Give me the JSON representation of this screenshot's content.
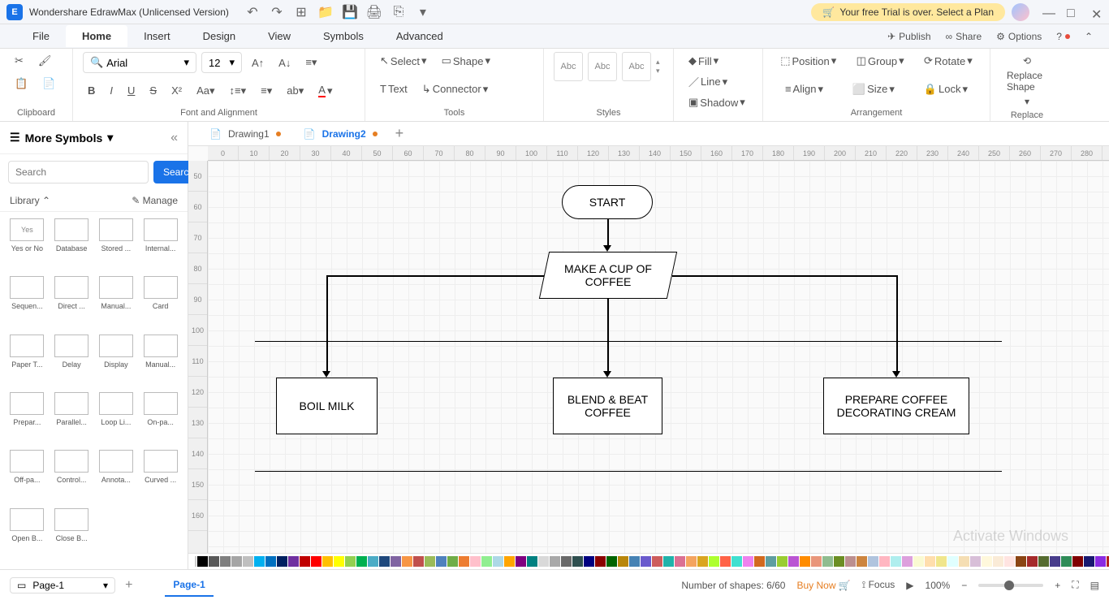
{
  "app": {
    "title": "Wondershare EdrawMax (Unlicensed Version)"
  },
  "trial": {
    "text": "Your free Trial is over. Select a Plan"
  },
  "menu": {
    "items": [
      "File",
      "Home",
      "Insert",
      "Design",
      "View",
      "Symbols",
      "Advanced"
    ],
    "active": "Home",
    "right": {
      "publish": "Publish",
      "share": "Share",
      "options": "Options"
    }
  },
  "ribbon": {
    "clipboard": {
      "label": "Clipboard"
    },
    "font": {
      "name": "Arial",
      "size": "12",
      "label": "Font and Alignment"
    },
    "tools": {
      "select": "Select",
      "shape": "Shape",
      "text": "Text",
      "connector": "Connector",
      "label": "Tools"
    },
    "styles": {
      "abc": "Abc",
      "label": "Styles"
    },
    "shapeOps": {
      "fill": "Fill",
      "line": "Line",
      "shadow": "Shadow"
    },
    "arrangement": {
      "position": "Position",
      "group": "Group",
      "rotate": "Rotate",
      "align": "Align",
      "size": "Size",
      "lock": "Lock",
      "label": "Arrangement"
    },
    "replace": {
      "label": "Replace",
      "btn": "Replace Shape"
    }
  },
  "leftPanel": {
    "title": "More Symbols",
    "searchPlaceholder": "Search",
    "searchBtn": "Search",
    "library": "Library",
    "manage": "Manage",
    "shapes": [
      {
        "label": "Yes or No",
        "txt": "Yes"
      },
      {
        "label": "Database",
        "txt": ""
      },
      {
        "label": "Stored ...",
        "txt": ""
      },
      {
        "label": "Internal...",
        "txt": ""
      },
      {
        "label": "Sequen...",
        "txt": ""
      },
      {
        "label": "Direct ...",
        "txt": ""
      },
      {
        "label": "Manual...",
        "txt": ""
      },
      {
        "label": "Card",
        "txt": ""
      },
      {
        "label": "Paper T...",
        "txt": ""
      },
      {
        "label": "Delay",
        "txt": ""
      },
      {
        "label": "Display",
        "txt": ""
      },
      {
        "label": "Manual...",
        "txt": ""
      },
      {
        "label": "Prepar...",
        "txt": ""
      },
      {
        "label": "Parallel...",
        "txt": ""
      },
      {
        "label": "Loop Li...",
        "txt": ""
      },
      {
        "label": "On-pa...",
        "txt": ""
      },
      {
        "label": "Off-pa...",
        "txt": ""
      },
      {
        "label": "Control...",
        "txt": ""
      },
      {
        "label": "Annota...",
        "txt": ""
      },
      {
        "label": "Curved ...",
        "txt": ""
      },
      {
        "label": "Open B...",
        "txt": ""
      },
      {
        "label": "Close B...",
        "txt": ""
      }
    ]
  },
  "docTabs": {
    "tabs": [
      {
        "name": "Drawing1",
        "active": false
      },
      {
        "name": "Drawing2",
        "active": true
      }
    ]
  },
  "rulerH": [
    "0",
    "10",
    "20",
    "30",
    "40",
    "50",
    "60",
    "70",
    "80",
    "90",
    "100",
    "110",
    "120",
    "130",
    "140",
    "150",
    "160",
    "170",
    "180",
    "190",
    "200",
    "210",
    "220",
    "230",
    "240",
    "250",
    "260",
    "270",
    "280"
  ],
  "rulerV": [
    "50",
    "60",
    "70",
    "80",
    "90",
    "100",
    "110",
    "120",
    "130",
    "140",
    "150",
    "160"
  ],
  "flowchart": {
    "start": "START",
    "makeCoffee": "MAKE A CUP OF COFFEE",
    "boilMilk": "BOIL MILK",
    "blendBeat": "BLEND & BEAT COFFEE",
    "prepareCream": "PREPARE COFFEE DECORATING CREAM"
  },
  "watermark": "Activate Windows",
  "statusBar": {
    "page": "Page-1",
    "pageTab": "Page-1",
    "shapesCount": "Number of shapes: 6/60",
    "buyNow": "Buy Now",
    "focus": "Focus",
    "zoom": "100%"
  },
  "colors": [
    "#000",
    "#595959",
    "#7f7f7f",
    "#a5a5a5",
    "#bfbfbf",
    "#00b0f0",
    "#0070c0",
    "#002060",
    "#7030a0",
    "#c00000",
    "#ff0000",
    "#ffc000",
    "#ffff00",
    "#92d050",
    "#00b050",
    "#4bacc6",
    "#1f497d",
    "#8064a2",
    "#f79646",
    "#c0504d",
    "#9bbb59",
    "#4f81bd",
    "#70ad47",
    "#ed7d31",
    "#ffc0cb",
    "#90ee90",
    "#add8e6",
    "#ffa500",
    "#800080",
    "#008080",
    "#d9d9d9",
    "#a9a9a9",
    "#696969",
    "#2f4f4f",
    "#000080",
    "#8b0000",
    "#006400",
    "#b8860b",
    "#4682b4",
    "#6a5acd",
    "#cd5c5c",
    "#20b2aa",
    "#db7093",
    "#f4a460",
    "#daa520",
    "#adff2f",
    "#ff6347",
    "#40e0d0",
    "#ee82ee",
    "#d2691e",
    "#5f9ea0",
    "#9acd32",
    "#ba55d3",
    "#ff8c00",
    "#e9967a",
    "#8fbc8f",
    "#6b8e23",
    "#bc8f8f",
    "#cd853f",
    "#b0c4de",
    "#ffb6c1",
    "#afeeee",
    "#dda0dd",
    "#fafad2",
    "#ffdead",
    "#f0e68c",
    "#e0ffff",
    "#f5deb3",
    "#d8bfd8",
    "#fff8dc",
    "#faebd7",
    "#ffe4e1",
    "#8b4513",
    "#a52a2a",
    "#556b2f",
    "#483d8b",
    "#2e8b57",
    "#800000",
    "#191970",
    "#8a2be2",
    "#b22222"
  ]
}
